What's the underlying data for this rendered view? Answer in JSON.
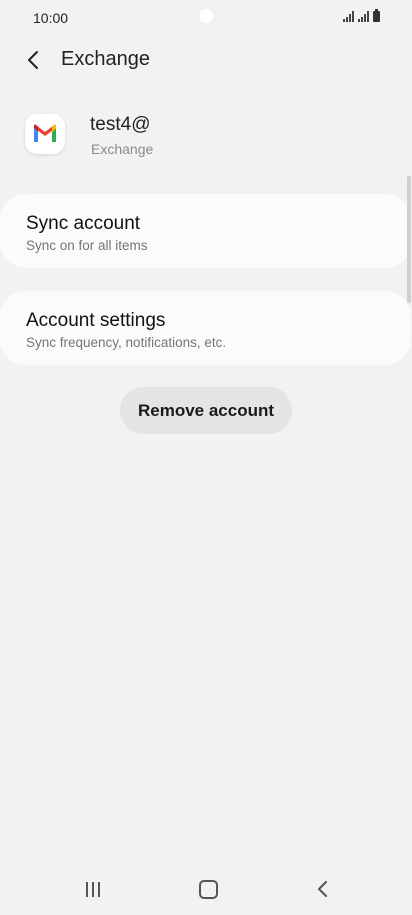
{
  "status_bar": {
    "time": "10:00"
  },
  "header": {
    "title": "Exchange"
  },
  "account": {
    "email": "test4@",
    "type": "Exchange",
    "icon": "gmail-icon"
  },
  "items": [
    {
      "title": "Sync account",
      "subtitle": "Sync on for all items"
    },
    {
      "title": "Account settings",
      "subtitle": "Sync frequency, notifications, etc."
    }
  ],
  "actions": {
    "remove_label": "Remove account"
  },
  "nav": {
    "recent": "recent-apps-icon",
    "home": "home-icon",
    "back": "back-icon"
  }
}
